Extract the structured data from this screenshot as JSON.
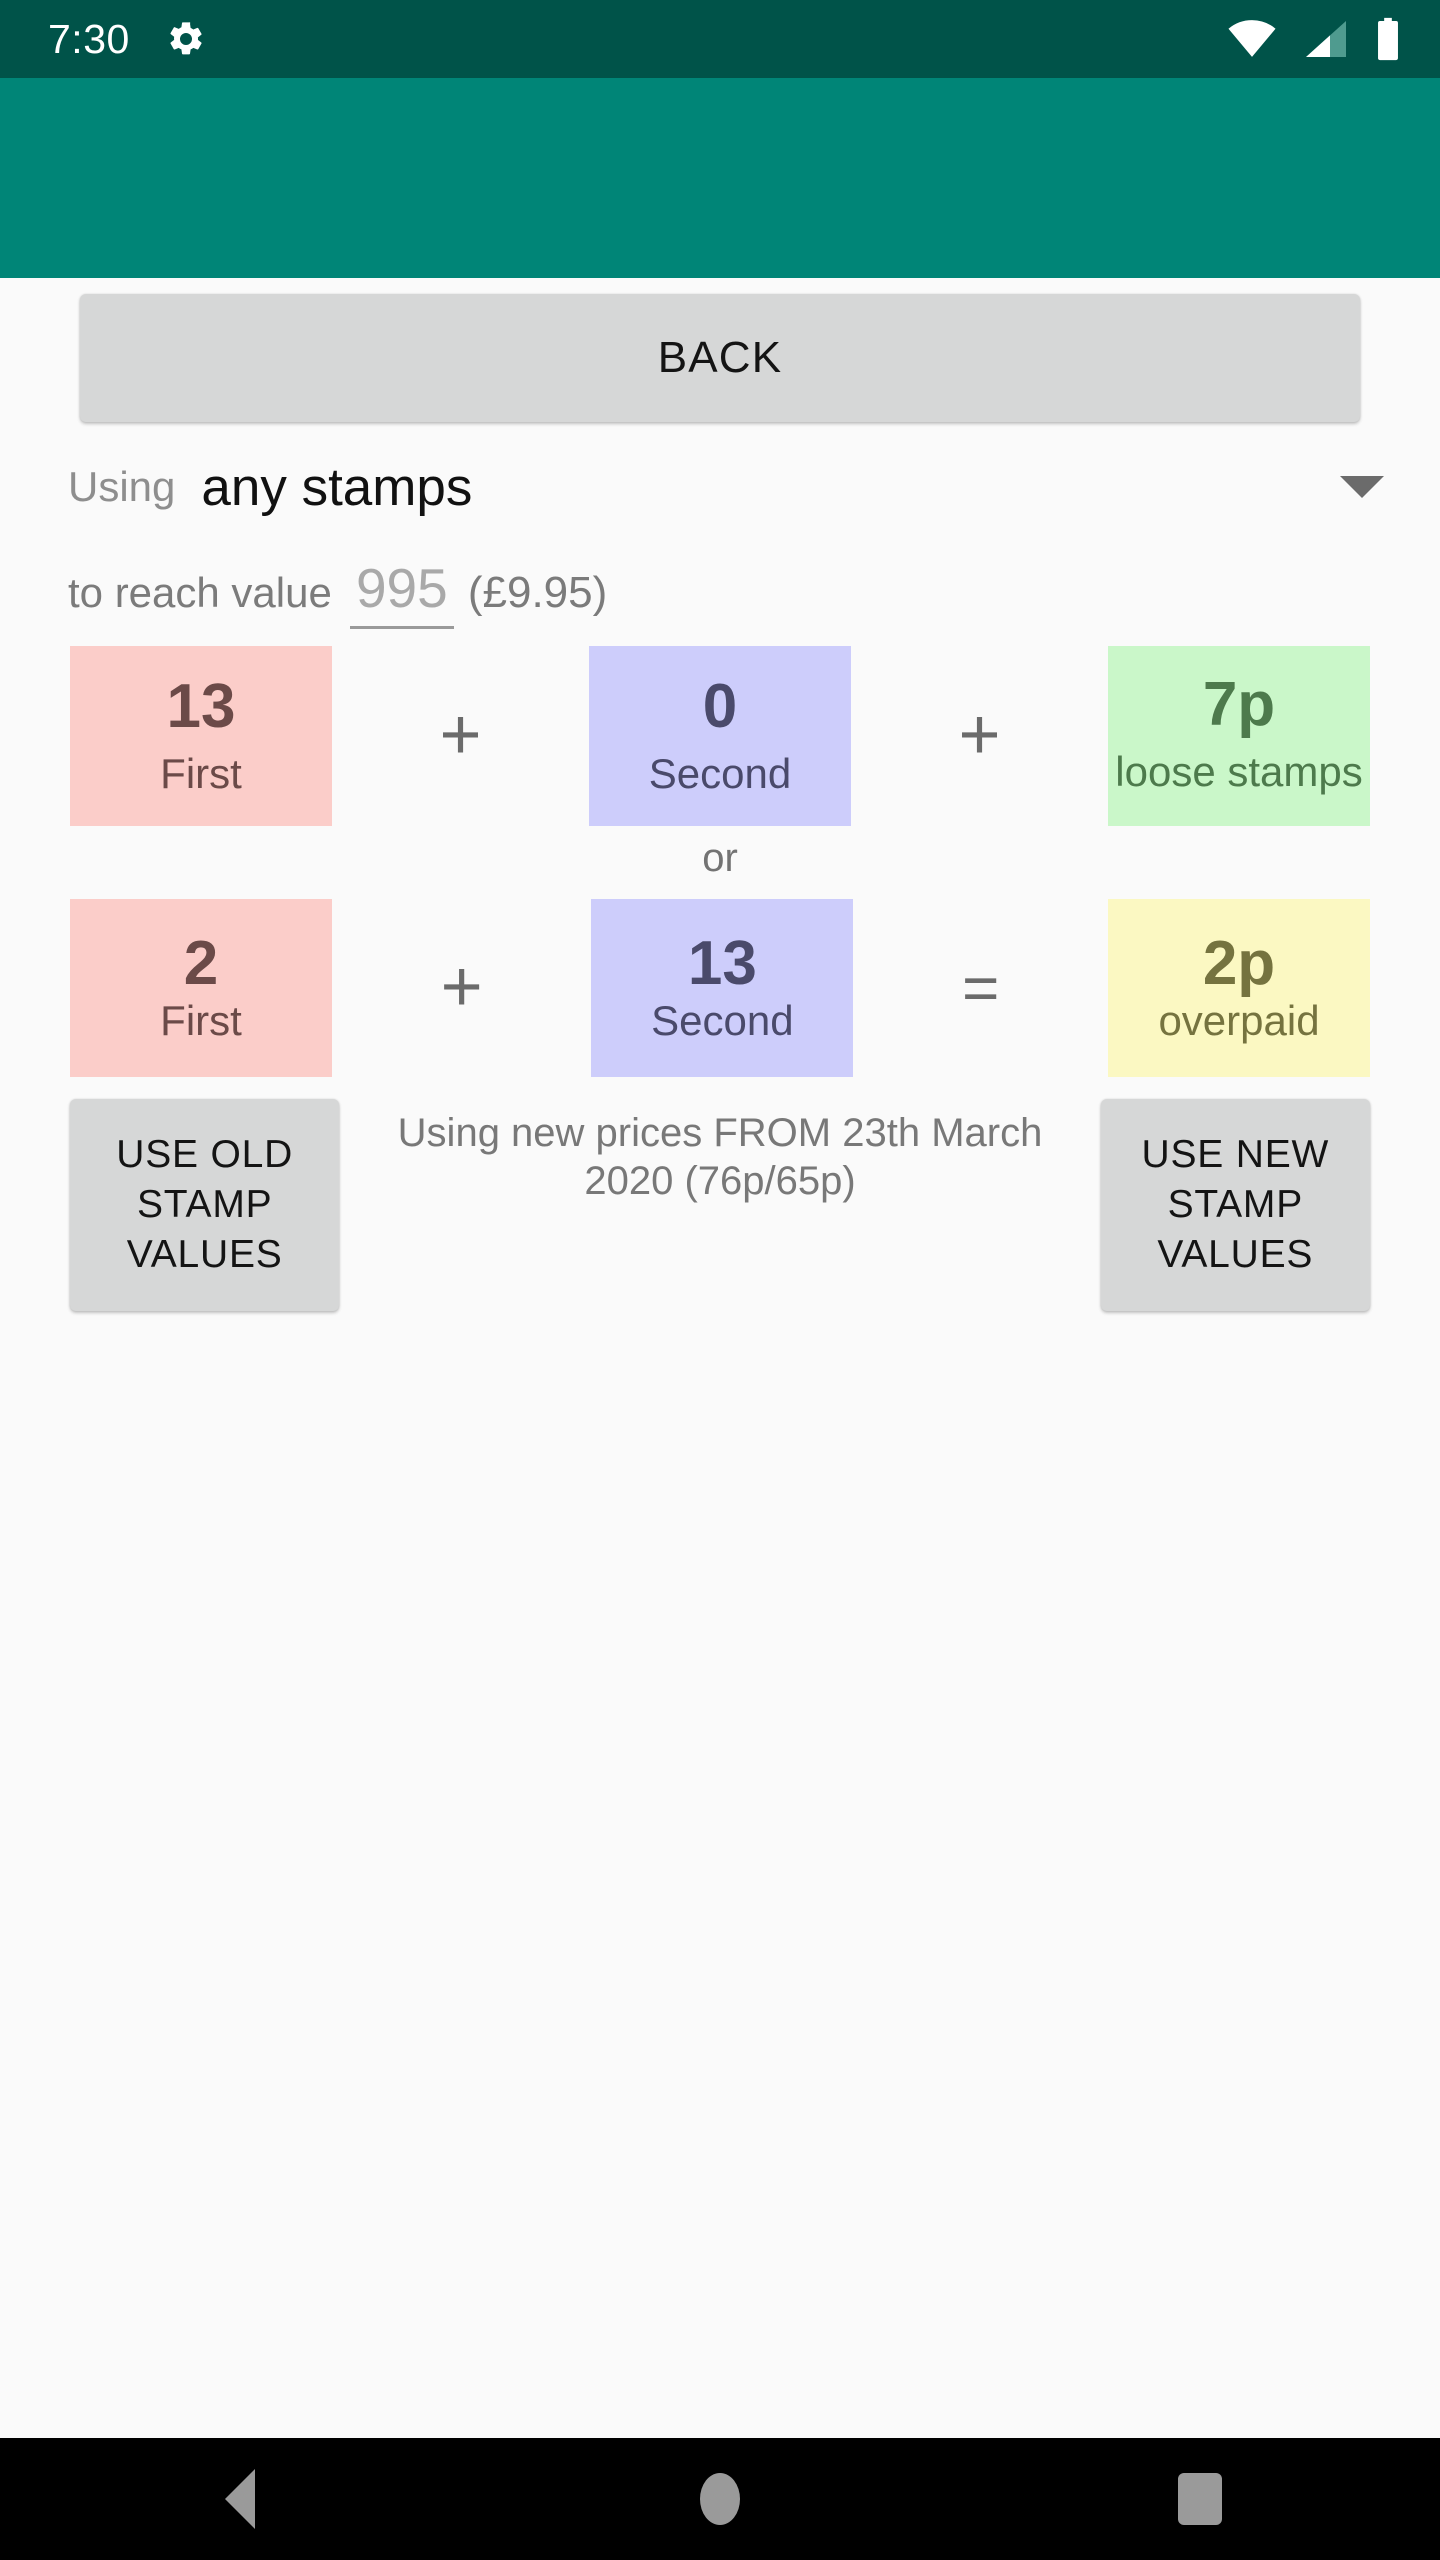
{
  "status_bar": {
    "time": "7:30",
    "gear_icon": "gear-icon",
    "wifi_icon": "wifi-icon",
    "signal_icon": "cell-signal-icon",
    "battery_icon": "battery-icon",
    "background": "#005349"
  },
  "app_bar": {
    "background": "#008577"
  },
  "back_button": {
    "label": "BACK"
  },
  "using": {
    "label": "Using",
    "value": "any stamps",
    "caret_icon": "chevron-down-icon"
  },
  "reach_value": {
    "label": "to reach value",
    "value": "995",
    "placeholder": "995",
    "pounds": "(£9.95)"
  },
  "row1": {
    "cards": [
      {
        "value": "13",
        "label": "First",
        "bg": "#fbcdc9",
        "fg": "#6b4a48"
      },
      {
        "value": "0",
        "label": "Second",
        "bg": "#cdcdfb",
        "fg": "#4a4a6b"
      },
      {
        "value": "7p",
        "label": "loose stamps",
        "bg": "#caf7c9",
        "fg": "#4d7a4c"
      }
    ],
    "operators": [
      "+",
      "+"
    ]
  },
  "or_separator": "or",
  "row2": {
    "cards": [
      {
        "value": "2",
        "label": "First",
        "bg": "#fbcdc9",
        "fg": "#6b4a48"
      },
      {
        "value": "13",
        "label": "Second",
        "bg": "#cdcdfb",
        "fg": "#4a4a6b"
      },
      {
        "value": "2p",
        "label": "overpaid",
        "bg": "#fbf8c2",
        "fg": "#75733f"
      }
    ],
    "operators": [
      "+",
      "="
    ]
  },
  "bottom": {
    "old_button": "USE OLD STAMP VALUES",
    "new_button": "USE NEW STAMP VALUES",
    "prices_note": "Using new prices FROM 23th March 2020 (76p/65p)"
  },
  "nav_bar": {
    "back_icon": "nav-back-icon",
    "home_icon": "nav-home-icon",
    "recents_icon": "nav-recents-icon"
  }
}
